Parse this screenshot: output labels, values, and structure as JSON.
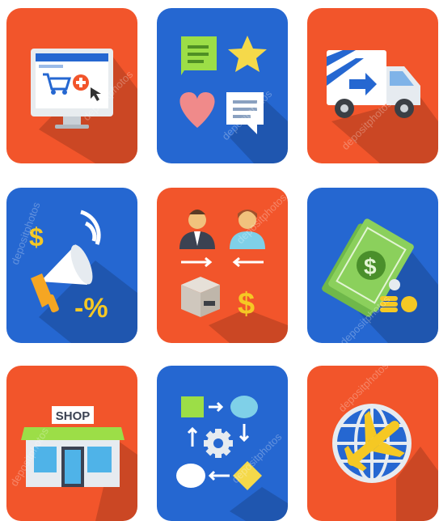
{
  "watermark": "depositphotos",
  "colors": {
    "red": "#f2552b",
    "blue": "#2567d1",
    "green": "#4caa3a",
    "yellow": "#f5c824"
  },
  "tiles": [
    {
      "icon": "online-shop-computer-icon",
      "bg": "red"
    },
    {
      "icon": "feedback-chat-star-heart-icon",
      "bg": "blue"
    },
    {
      "icon": "delivery-truck-icon",
      "bg": "red"
    },
    {
      "icon": "marketing-megaphone-icon",
      "bg": "blue",
      "texts": {
        "dollar": "$",
        "discount": "-%"
      }
    },
    {
      "icon": "trade-exchange-icon",
      "bg": "red",
      "texts": {
        "dollar": "$"
      }
    },
    {
      "icon": "money-banknotes-icon",
      "bg": "blue",
      "texts": {
        "dollar": "$"
      }
    },
    {
      "icon": "shop-storefront-icon",
      "bg": "red",
      "texts": {
        "sign": "SHOP"
      }
    },
    {
      "icon": "process-flowchart-icon",
      "bg": "blue"
    },
    {
      "icon": "globe-airplane-icon",
      "bg": "red"
    }
  ]
}
